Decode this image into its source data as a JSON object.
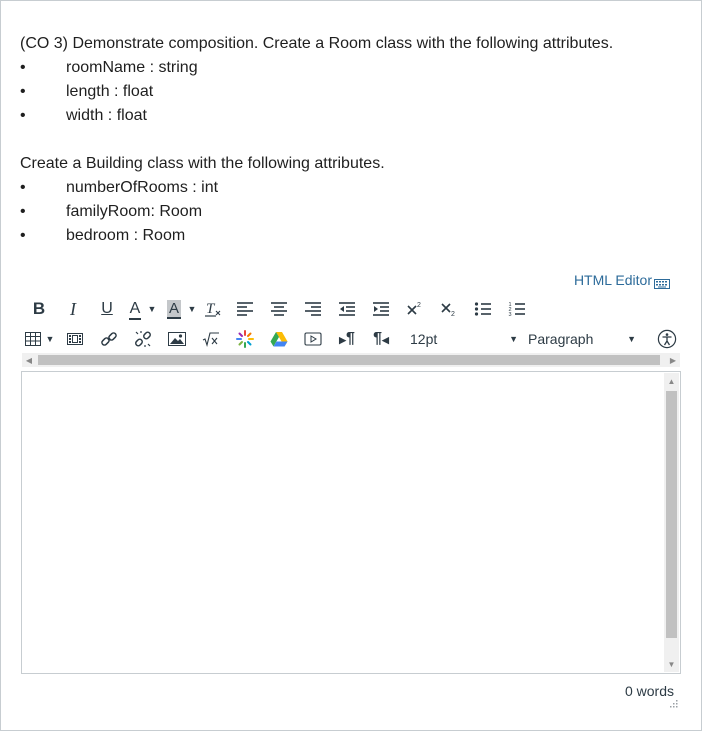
{
  "question": {
    "intro": "(CO 3) Demonstrate composition. Create a Room class with the following attributes.",
    "room_attributes": [
      "roomName : string",
      "length : float",
      "width : float"
    ],
    "building_intro": "Create a Building class with the following attributes.",
    "building_attributes": [
      "numberOfRooms : int",
      "familyRoom: Room",
      "bedroom : Room"
    ],
    "bullet": "•"
  },
  "editor": {
    "html_editor_link": "HTML Editor",
    "font_size": "12pt",
    "block_format": "Paragraph",
    "content": "",
    "word_count": "0 words"
  },
  "icons": {
    "bold": "B",
    "italic": "I",
    "underline": "U",
    "text_color": "A",
    "bg_color": "A",
    "pilcrow": "¶"
  },
  "colors": {
    "link": "#2d6b9a",
    "toolbar_icon": "#2d3b45",
    "border": "#c7cdd1",
    "scroll_thumb": "#c1c1c1"
  }
}
